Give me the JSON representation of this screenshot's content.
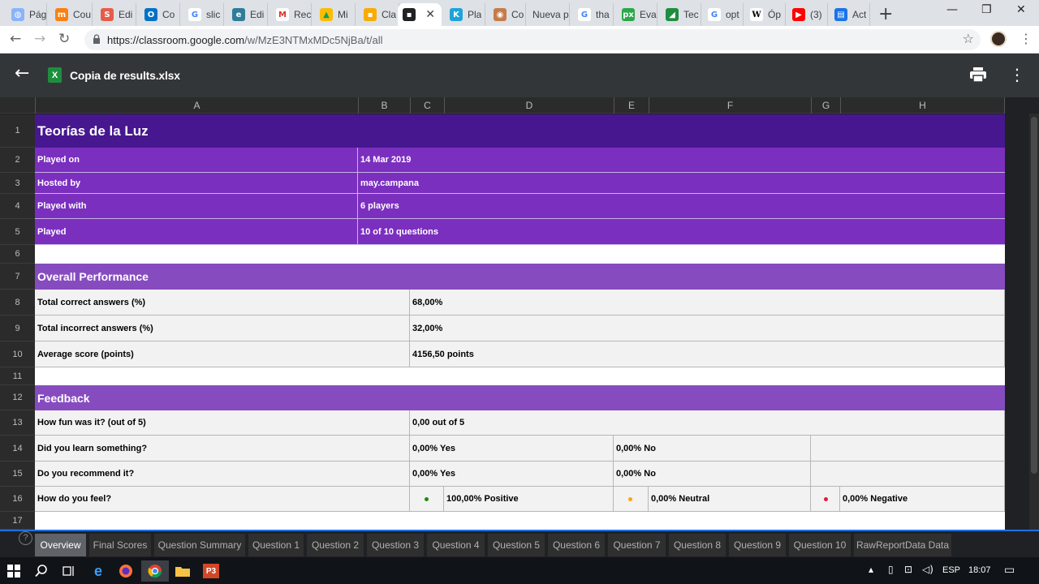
{
  "browser": {
    "tabs": [
      {
        "title": "Pág",
        "icon": "globe-icon",
        "color": "#5f6368"
      },
      {
        "title": "Cou",
        "icon": "moodle-icon",
        "color": "#f98012"
      },
      {
        "title": "Edi",
        "icon": "slides-s-icon",
        "color": "#e55d4a"
      },
      {
        "title": "Co",
        "icon": "outlook-icon",
        "color": "#0072c6"
      },
      {
        "title": "slic",
        "icon": "google-icon",
        "color": "#4285f4"
      },
      {
        "title": "Edi",
        "icon": "edu-icon",
        "color": "#2e7d9a"
      },
      {
        "title": "Rec",
        "icon": "gmail-icon",
        "color": "#d93025"
      },
      {
        "title": "Mi",
        "icon": "drive-icon",
        "color": "#34a853"
      },
      {
        "title": "Cla",
        "icon": "classroom-icon",
        "color": "#f9ab00"
      },
      {
        "title": "",
        "icon": "classroom-viewer-icon",
        "color": "#202124"
      },
      {
        "title": "Pla",
        "icon": "kahoot-icon",
        "color": "#1fa4d9"
      },
      {
        "title": "Co",
        "icon": "palette-icon",
        "color": "#c67b4a"
      },
      {
        "title": "Nueva p",
        "icon": "",
        "color": "#dee1e6"
      },
      {
        "title": "tha",
        "icon": "google-icon",
        "color": "#4285f4"
      },
      {
        "title": "Eva",
        "icon": "px-icon",
        "color": "#2ba84a"
      },
      {
        "title": "Tec",
        "icon": "chart-icon",
        "color": "#1e8e3e"
      },
      {
        "title": "opt",
        "icon": "google-icon",
        "color": "#4285f4"
      },
      {
        "title": "Óp",
        "icon": "wikipedia-icon",
        "color": "#000000"
      },
      {
        "title": "(3)",
        "icon": "youtube-icon",
        "color": "#ff0000"
      },
      {
        "title": "Act",
        "icon": "document-icon",
        "color": "#1a73e8"
      }
    ],
    "url_domain": "https://classroom.google.com",
    "url_path": "/w/MzE3NTMxMDc5NjBa/t/all"
  },
  "viewer": {
    "file_name": "Copia de results.xlsx",
    "excel_letter": "X"
  },
  "sheet": {
    "columns": [
      "A",
      "B",
      "C",
      "D",
      "E",
      "F",
      "G",
      "H"
    ],
    "row_numbers": [
      "1",
      "2",
      "3",
      "4",
      "5",
      "6",
      "7",
      "8",
      "9",
      "10",
      "11",
      "12",
      "13",
      "14",
      "15",
      "16",
      "17"
    ],
    "title": "Teorías de la Luz",
    "info": [
      {
        "label": "Played on",
        "value": "14 Mar 2019"
      },
      {
        "label": "Hosted by",
        "value": "may.campana"
      },
      {
        "label": "Played with",
        "value": "6 players"
      },
      {
        "label": "Played",
        "value": "10 of 10 questions"
      }
    ],
    "overall_title": "Overall Performance",
    "overall": [
      {
        "label": "Total correct answers (%)",
        "value": "68,00%"
      },
      {
        "label": "Total incorrect answers (%)",
        "value": "32,00%"
      },
      {
        "label": "Average score (points)",
        "value": "4156,50 points"
      }
    ],
    "feedback_title": "Feedback",
    "feedback": {
      "fun_label": "How fun was it? (out of 5)",
      "fun_value": "0,00 out of 5",
      "learn_label": "Did you learn something?",
      "learn_yes": "0,00% Yes",
      "learn_no": "0,00% No",
      "recommend_label": "Do you recommend it?",
      "recommend_yes": "0,00% Yes",
      "recommend_no": "0,00% No",
      "feel_label": "How do you feel?",
      "positive": "100,00% Positive",
      "neutral": "0,00% Neutral",
      "negative": "0,00% Negative"
    },
    "colors": {
      "title_bg": "#46178f",
      "info_bg": "#7b2fbf",
      "section_bg": "#864cbf",
      "positive_dot": "#26890c",
      "neutral_dot": "#ffa602",
      "negative_dot": "#e21b3c"
    }
  },
  "sheet_tabs": [
    "Overview",
    "Final Scores",
    "Question Summary",
    "Question 1",
    "Question 2",
    "Question 3",
    "Question 4",
    "Question 5",
    "Question 6",
    "Question 7",
    "Question 8",
    "Question 9",
    "Question 10",
    "RawReportData Data"
  ],
  "taskbar": {
    "lang": "ESP",
    "time": "18:07"
  }
}
